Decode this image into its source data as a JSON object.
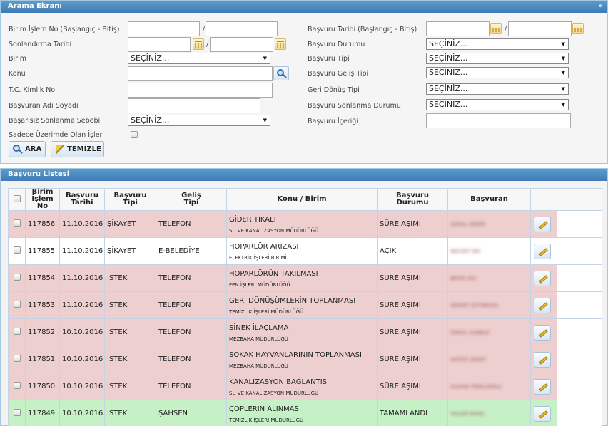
{
  "search_panel": {
    "title": "Arama Ekranı",
    "collapse": "«",
    "labels": {
      "islem_no": "Birim İşlem No (Başlangıç - Bitiş)",
      "sonlandirma": "Sonlandırma Tarihi",
      "birim": "Birim",
      "konu": "Konu",
      "tc": "T.C. Kimlik No",
      "adsoyad": "Başvuran Adı Soyadı",
      "basarisiz": "Başarısız Sonlanma Sebebi",
      "sadece": "Sadece Üzerimde Olan İşler",
      "basvuru_tarihi": "Başvuru Tarihi (Başlangıç - Bitiş)",
      "basvuru_durumu": "Başvuru Durumu",
      "basvuru_tipi": "Başvuru Tipi",
      "gelis_tipi": "Başvuru Geliş Tipi",
      "geri_donus": "Geri Dönüş Tipi",
      "sonlanma_durumu": "Başvuru Sonlanma Durumu",
      "icerigi": "Başvuru İçeriği"
    },
    "slash": "/",
    "select_default": "SEÇİNİZ...",
    "search_button": "ARA",
    "clear_button": "TEMİZLE"
  },
  "list_panel": {
    "title": "Başvuru Listesi",
    "columns": [
      "Birim\nİşlem No",
      "Başvuru\nTarihi",
      "Başvuru\nTipi",
      "Geliş\nTipi",
      "Konu / Birim",
      "Başvuru Durumu",
      "Başvuran"
    ],
    "rows": [
      {
        "no": "117856",
        "tarih": "11.10.2016",
        "tip": "ŞİKAYET",
        "gelis": "TELEFON",
        "konu": "GİDER TIKALI",
        "birim": "SU VE KANALİZASYON MÜDÜRLÜĞÜ",
        "durum": "SÜRE AŞIMI",
        "basvuran": "CEMAL DEMİR",
        "style": "red"
      },
      {
        "no": "117855",
        "tarih": "11.10.2016",
        "tip": "ŞİKAYET",
        "gelis": "E-BELEDİYE",
        "konu": "HOPARLÖR ARIZASI",
        "birim": "ELEKTRİK İŞLERİ BİRİMİ",
        "durum": "AÇIK",
        "basvuran": "NECDET EKİ",
        "style": "white"
      },
      {
        "no": "117854",
        "tarih": "11.10.2016",
        "tip": "İSTEK",
        "gelis": "TELEFON",
        "konu": "HOPARLÖRÜN TAKILMASI",
        "birim": "FEN İŞLERİ MÜDÜRLÜĞÜ",
        "durum": "SÜRE AŞIMI",
        "basvuran": "BEKİR YAZ",
        "style": "red"
      },
      {
        "no": "117853",
        "tarih": "11.10.2016",
        "tip": "İSTEK",
        "gelis": "TELEFON",
        "konu": "GERİ DÖNÜŞÜMLERİN TOPLANMASI",
        "birim": "TEMİZLİK İŞLERİ MÜDÜRLÜĞÜ",
        "durum": "SÜRE AŞIMI",
        "basvuran": "SERVET ÇETİNKAYA",
        "style": "red"
      },
      {
        "no": "117852",
        "tarih": "10.10.2016",
        "tip": "İSTEK",
        "gelis": "TELEFON",
        "konu": "SİNEK İLAÇLAMA",
        "birim": "MEZBAHA MÜDÜRLÜĞÜ",
        "durum": "SÜRE AŞIMI",
        "basvuran": "İSMAİL CANBAZ",
        "style": "red"
      },
      {
        "no": "117851",
        "tarih": "10.10.2016",
        "tip": "İSTEK",
        "gelis": "TELEFON",
        "konu": "SOKAK HAYVANLARININ TOPLANMASI",
        "birim": "MEZBAHA MÜDÜRLÜĞÜ",
        "durum": "SÜRE AŞIMI",
        "basvuran": "HATİCE ZEREY",
        "style": "red"
      },
      {
        "no": "117850",
        "tarih": "10.10.2016",
        "tip": "İSTEK",
        "gelis": "TELEFON",
        "konu": "KANALİZASYON BAĞLANTISI",
        "birim": "SU VE KANALİZASYON MÜDÜRLÜĞÜ",
        "durum": "SÜRE AŞIMI",
        "basvuran": "SULTAN TEKELİOĞLU",
        "style": "red"
      },
      {
        "no": "117849",
        "tarih": "10.10.2016",
        "tip": "İSTEK",
        "gelis": "ŞAHSEN",
        "konu": "ÇÖPLERİN ALINMASI",
        "birim": "TEMİZLİK İŞLERİ MÜDÜRLÜĞÜ",
        "durum": "TAMAMLANDI",
        "basvuran": "YALÇIN KAVAL",
        "style": "green"
      }
    ]
  },
  "colors": {
    "header": "#5c9ccc",
    "red_row": "#edcfcf",
    "green_row": "#c6f0c6"
  }
}
